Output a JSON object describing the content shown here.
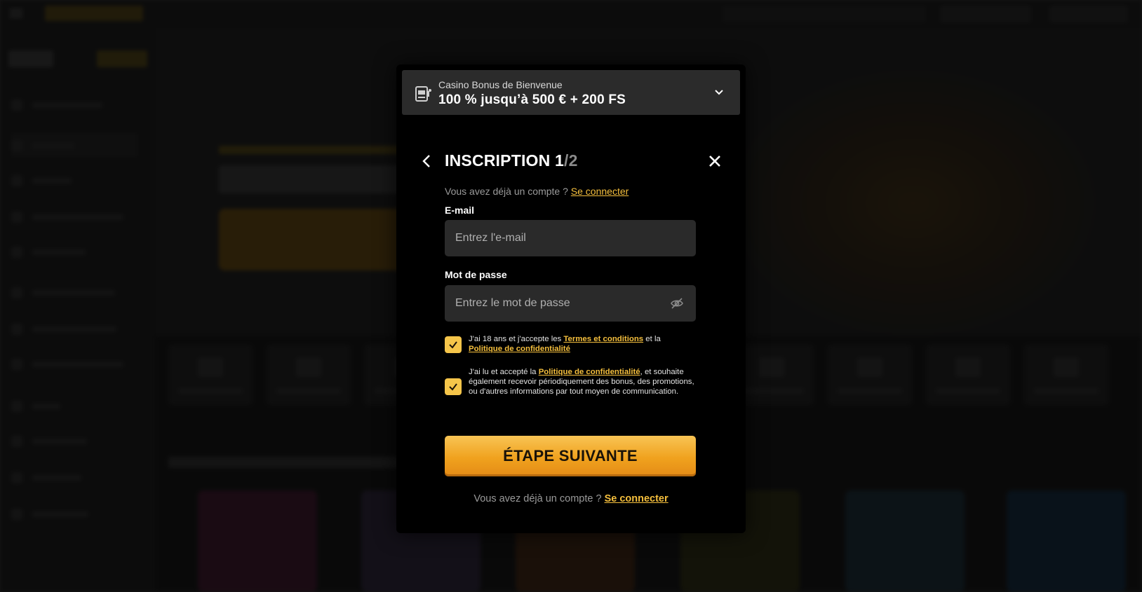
{
  "bonus": {
    "label": "Casino Bonus de Bienvenue",
    "offer": "100 % jusqu’à 500 € + 200 FS"
  },
  "registration": {
    "title": "INSCRIPTION",
    "step_current": "1",
    "step_total": "/2",
    "have_account_text": "Vous avez déjà un compte ?",
    "login_link": "Se connecter",
    "email_label": "E-mail",
    "email_placeholder": "Entrez l'e-mail",
    "email_value": "",
    "password_label": "Mot de passe",
    "password_placeholder": "Entrez le mot de passe",
    "password_value": "",
    "consent_terms": {
      "checked": true,
      "text_before": "J'ai 18 ans et j'accepte les ",
      "terms_link": "Termes et conditions",
      "text_middle": " et la ",
      "privacy_link": "Politique de confidentialité"
    },
    "consent_marketing": {
      "checked": true,
      "text_before": "J'ai lu et accepté la ",
      "privacy_link": "Politique de confidentialité",
      "text_after": ", et souhaite également recevoir périodiquement des bonus, des promotions, ou d'autres informations par tout moyen de communication."
    },
    "next_button": "ÉTAPE SUIVANTE",
    "bottom_have_account_text": "Vous avez déjà un compte ?",
    "bottom_login_link": "Se connecter"
  },
  "colors": {
    "accent": "#f5bf3d",
    "button_top": "#f8c455",
    "button_bottom": "#e48b16",
    "modal_bg": "#000000",
    "field_bg": "#2a2a2a"
  }
}
